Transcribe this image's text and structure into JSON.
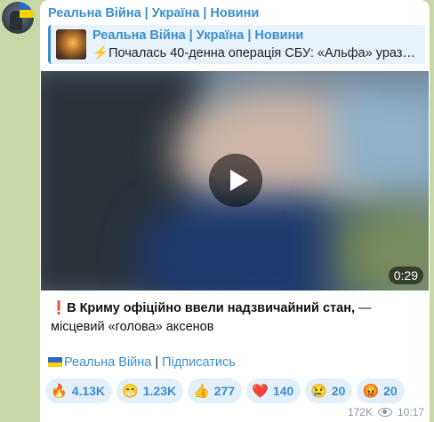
{
  "post": {
    "channel": "Реальна Війна | Україна | Новини",
    "reply": {
      "title": "Реальна Війна | Україна | Новини",
      "text": "Почалась 40-денна операція СБУ: «Альфа» уразили…"
    },
    "video": {
      "duration": "0:29"
    },
    "caption": {
      "bold": "В Криму офіційно ввели надзвичайний стан,",
      "rest": " — місцевий «голова» аксенов"
    },
    "links": {
      "channel": "Реальна Війна",
      "separator": " | ",
      "subscribe": "Підписатись"
    },
    "reactions": [
      {
        "emoji": "fire",
        "count": "4.13K"
      },
      {
        "emoji": "grin",
        "count": "1.23K"
      },
      {
        "emoji": "thumbs-up",
        "count": "277"
      },
      {
        "emoji": "heart",
        "count": "140"
      },
      {
        "emoji": "crying",
        "count": "20"
      },
      {
        "emoji": "angry",
        "count": "20"
      }
    ],
    "views": "172K",
    "time": "10:17"
  },
  "colors": {
    "accent": "#3a8fd0",
    "background": "#c7d8a4",
    "bubble": "#ffffff"
  }
}
